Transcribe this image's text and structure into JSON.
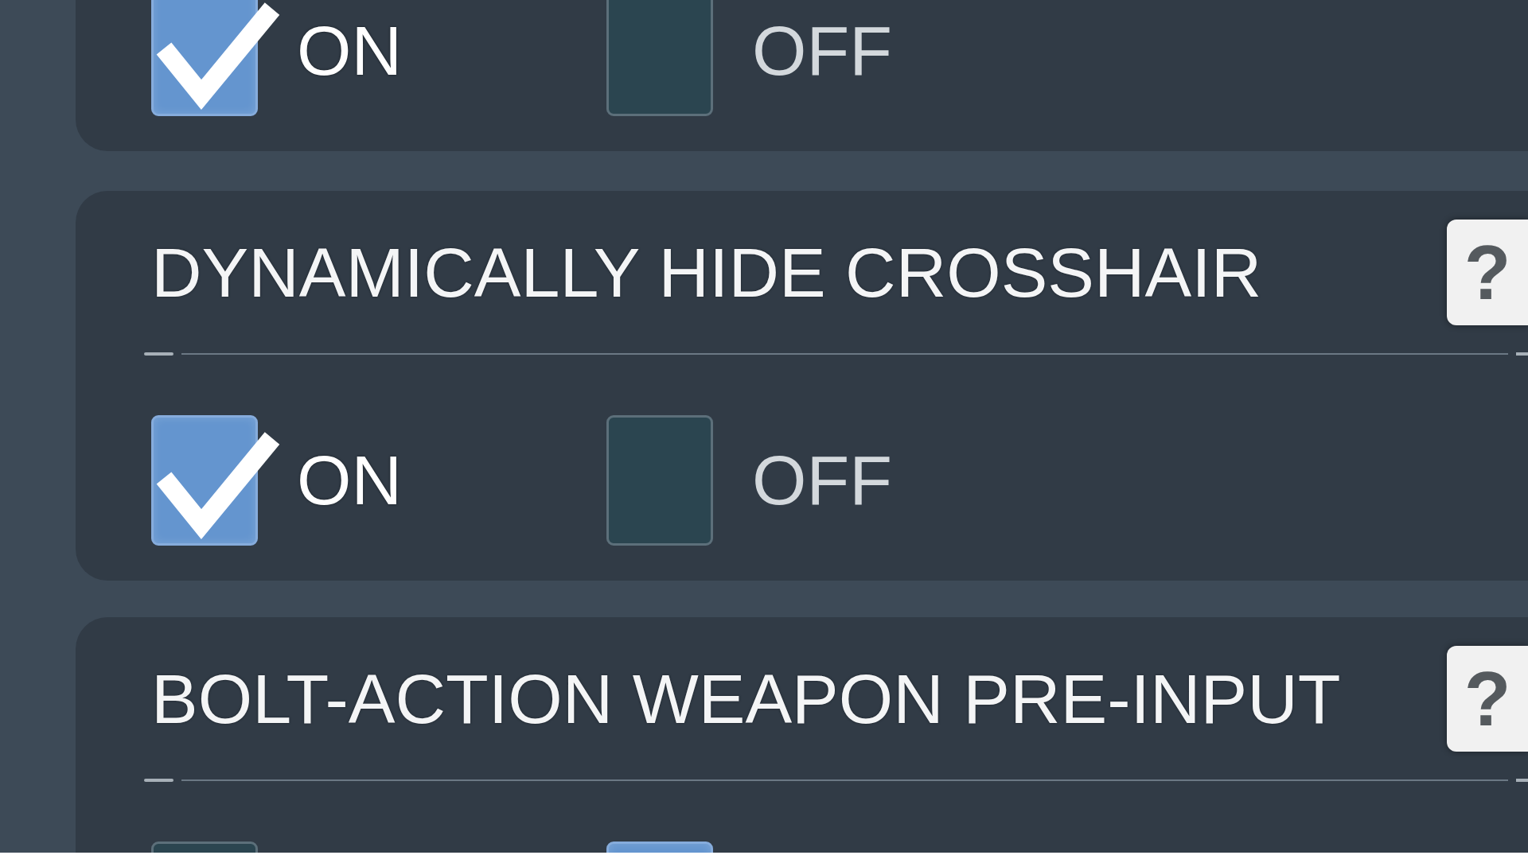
{
  "settings": [
    {
      "options": [
        {
          "label": "ON",
          "checked": true
        },
        {
          "label": "OFF",
          "checked": false
        }
      ]
    },
    {
      "title": "DYNAMICALLY HIDE CROSSHAIR",
      "help_button": "?",
      "options": [
        {
          "label": "ON",
          "checked": true
        },
        {
          "label": "OFF",
          "checked": false
        }
      ]
    },
    {
      "title": "BOLT-ACTION WEAPON PRE-INPUT",
      "help_button": "?",
      "options": [
        {
          "checked": false
        },
        {
          "checked": true
        }
      ]
    }
  ]
}
